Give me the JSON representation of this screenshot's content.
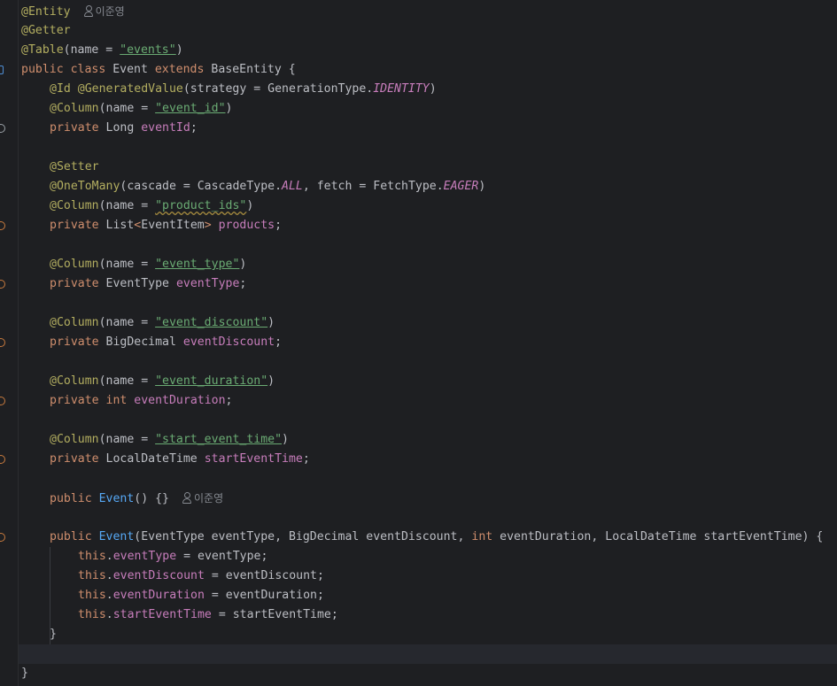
{
  "editor": {
    "author_hint": "이준영",
    "lines": {
      "l1": {
        "ann": "@Entity"
      },
      "l2": {
        "ann": "@Getter"
      },
      "l3": {
        "ann": "@Table",
        "p1": "(name = ",
        "s": "\"events\"",
        "p2": ")"
      },
      "l4": {
        "kw1": "public class ",
        "name": "Event ",
        "kw2": "extends ",
        "rest": "BaseEntity {"
      },
      "l5": {
        "ann1": "@Id ",
        "ann2": "@GeneratedValue",
        "p1": "(strategy = GenerationType.",
        "enum": "IDENTITY",
        "p2": ")"
      },
      "l6": {
        "ann": "@Column",
        "p1": "(name = ",
        "s": "\"event_id\"",
        "p2": ")"
      },
      "l7": {
        "kw": "private ",
        "type": "Long ",
        "field": "eventId",
        "end": ";"
      },
      "l9": {
        "ann": "@Setter"
      },
      "l10": {
        "ann": "@OneToMany",
        "p1": "(cascade = CascadeType.",
        "enum1": "ALL",
        "p2": ", fetch = FetchType.",
        "enum2": "EAGER",
        "p3": ")"
      },
      "l11": {
        "ann": "@Column",
        "p1": "(name = ",
        "s": "\"product_ids\"",
        "p2": ")"
      },
      "l12": {
        "kw": "private ",
        "type": "List",
        "lt": "<",
        "gen": "EventItem",
        "gt": "> ",
        "field": "products",
        "end": ";"
      },
      "l14": {
        "ann": "@Column",
        "p1": "(name = ",
        "s": "\"event_type\"",
        "p2": ")"
      },
      "l15": {
        "kw": "private ",
        "type": "EventType ",
        "field": "eventType",
        "end": ";"
      },
      "l17": {
        "ann": "@Column",
        "p1": "(name = ",
        "s": "\"event_discount\"",
        "p2": ")"
      },
      "l18": {
        "kw": "private ",
        "type": "BigDecimal ",
        "field": "eventDiscount",
        "end": ";"
      },
      "l20": {
        "ann": "@Column",
        "p1": "(name = ",
        "s": "\"event_duration\"",
        "p2": ")"
      },
      "l21": {
        "kw": "private ",
        "type": "int ",
        "field": "eventDuration",
        "end": ";"
      },
      "l23": {
        "ann": "@Column",
        "p1": "(name = ",
        "s": "\"start_event_time\"",
        "p2": ")"
      },
      "l24": {
        "kw": "private ",
        "type": "LocalDateTime ",
        "field": "startEventTime",
        "end": ";"
      },
      "l26": {
        "kw": "public ",
        "fn": "Event",
        "rest": "() {}"
      },
      "l28": {
        "kw": "public ",
        "fn": "Event",
        "p1": "(EventType eventType, BigDecimal eventDiscount, ",
        "kw2": "int ",
        "p2": "eventDuration, LocalDateTime startEventTime) {"
      },
      "l29": {
        "kw": "this",
        "dot": ".",
        "field": "eventType",
        "rest": " = eventType;"
      },
      "l30": {
        "kw": "this",
        "dot": ".",
        "field": "eventDiscount",
        "rest": " = eventDiscount;"
      },
      "l31": {
        "kw": "this",
        "dot": ".",
        "field": "eventDuration",
        "rest": " = eventDuration;"
      },
      "l32": {
        "kw": "this",
        "dot": ".",
        "field": "startEventTime",
        "rest": " = startEventTime;"
      },
      "l33": {
        "brace": "}"
      },
      "l35": {
        "brace": "}"
      }
    }
  },
  "colors": {
    "background": "#1e1f22",
    "annotation": "#b3ae60",
    "keyword": "#cf8e6d",
    "string": "#6aab73",
    "field": "#c77dbb",
    "method": "#56a8f5",
    "text": "#bcbec4",
    "hint": "#868a91"
  },
  "icons": [
    "user-icon",
    "gutter-marker"
  ]
}
